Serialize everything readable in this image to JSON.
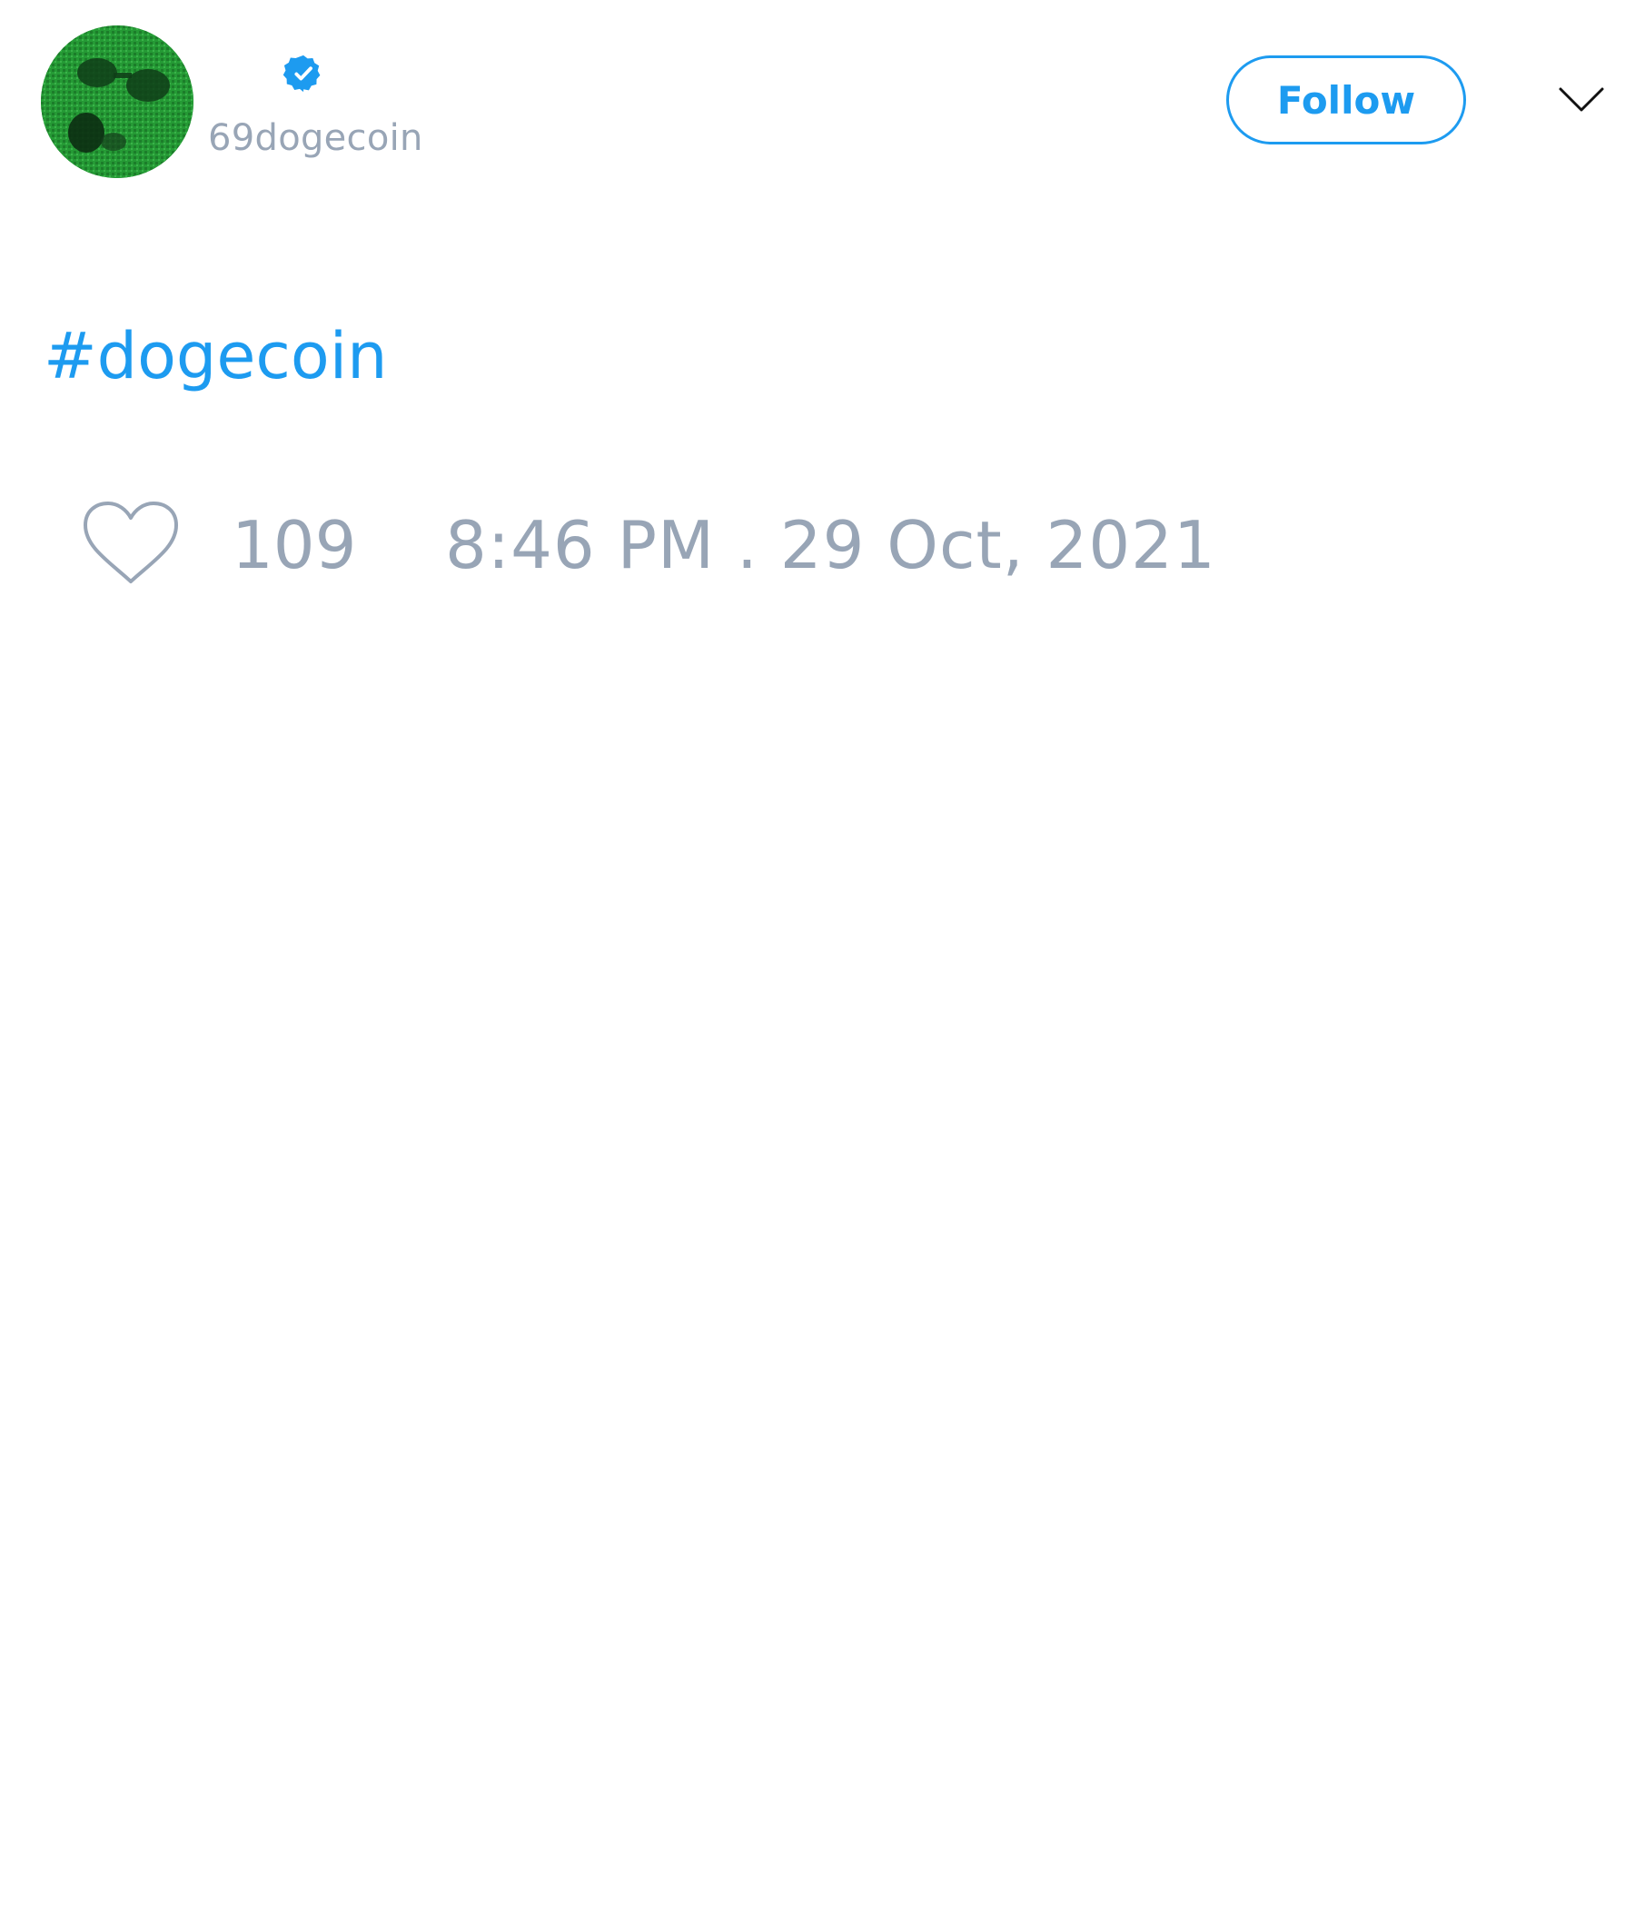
{
  "tweet": {
    "author": {
      "handle": "69dogecoin",
      "verified": true,
      "avatar_icon": "avatar-sunglasses-icon"
    },
    "follow_label": "Follow",
    "menu_icon": "chevron-down-icon",
    "text": "#dogecoin",
    "like_icon": "heart-outline-icon",
    "like_count": "109",
    "timestamp": "8:46 PM . 29 Oct, 2021"
  },
  "colors": {
    "accent": "#1d9bf0",
    "muted_text": "#98a5b6",
    "avatar_green": "#1f8a2e"
  }
}
